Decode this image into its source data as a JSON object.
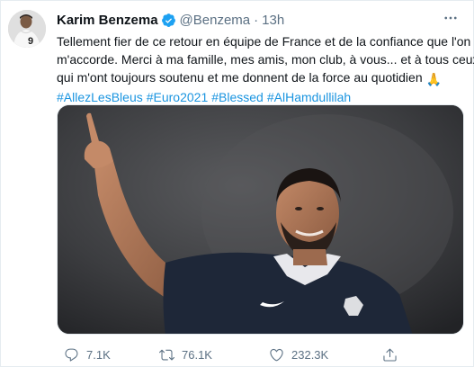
{
  "tweet": {
    "author_name": "Karim Benzema",
    "handle": "@Benzema",
    "separator": "·",
    "time": "13h",
    "text_lines": [
      "Tellement fier de ce retour en équipe de France et de la confiance que l'on",
      "m'accorde. Merci à ma famille, mes amis, mon club, à vous... et à tous ceux",
      "qui m'ont toujours soutenu et me donnent de la force au quotidien"
    ],
    "emoji": "🙏",
    "hashtags": [
      "#AllezLesBleus",
      "#Euro2021",
      "#Blessed",
      "#AlHamdullilah"
    ],
    "more_label": "···"
  },
  "actions": {
    "replies": "7.1K",
    "retweets": "76.1K",
    "likes": "232.3K"
  },
  "icons": {
    "verified": "verified-badge-icon",
    "more": "more-options-icon",
    "reply": "reply-icon",
    "retweet": "retweet-icon",
    "like": "heart-icon",
    "share": "share-icon"
  },
  "colors": {
    "link": "#1b95e0",
    "secondary_text": "#5b7083",
    "verified": "#1da1f2",
    "border": "#e6ecf0"
  }
}
